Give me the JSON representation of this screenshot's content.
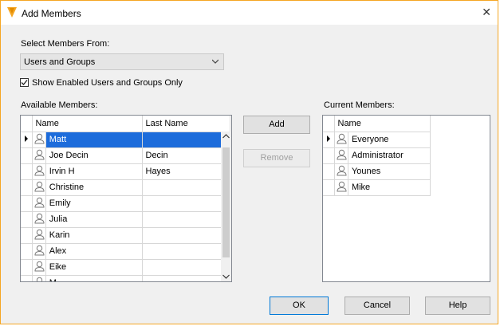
{
  "window": {
    "title": "Add Members",
    "close_symbol": "✕",
    "accent": "#f5a623"
  },
  "source": {
    "label": "Select Members From:",
    "selected": "Users and Groups"
  },
  "filter": {
    "label": "Show Enabled Users and Groups Only",
    "checked": true
  },
  "available": {
    "label": "Available Members:",
    "columns": [
      "Name",
      "Last Name"
    ],
    "rows": [
      {
        "name": "Matt",
        "last": "",
        "selected": true
      },
      {
        "name": "Joe Decin",
        "last": "Decin"
      },
      {
        "name": "Irvin H",
        "last": "Hayes"
      },
      {
        "name": "Christine",
        "last": ""
      },
      {
        "name": "Emily",
        "last": ""
      },
      {
        "name": "Julia",
        "last": ""
      },
      {
        "name": "Karin",
        "last": ""
      },
      {
        "name": "Alex",
        "last": ""
      },
      {
        "name": "Eike",
        "last": ""
      },
      {
        "name": "M",
        "last": ""
      }
    ]
  },
  "current": {
    "label": "Current Members:",
    "columns": [
      "Name"
    ],
    "rows": [
      "Everyone",
      "Administrator",
      "Younes",
      "Mike"
    ]
  },
  "actions": {
    "add": "Add",
    "remove": "Remove"
  },
  "footer": {
    "ok": "OK",
    "cancel": "Cancel",
    "help": "Help"
  },
  "colors": {
    "selection": "#1d6cdb",
    "user_icon": "#7a7a7a"
  }
}
